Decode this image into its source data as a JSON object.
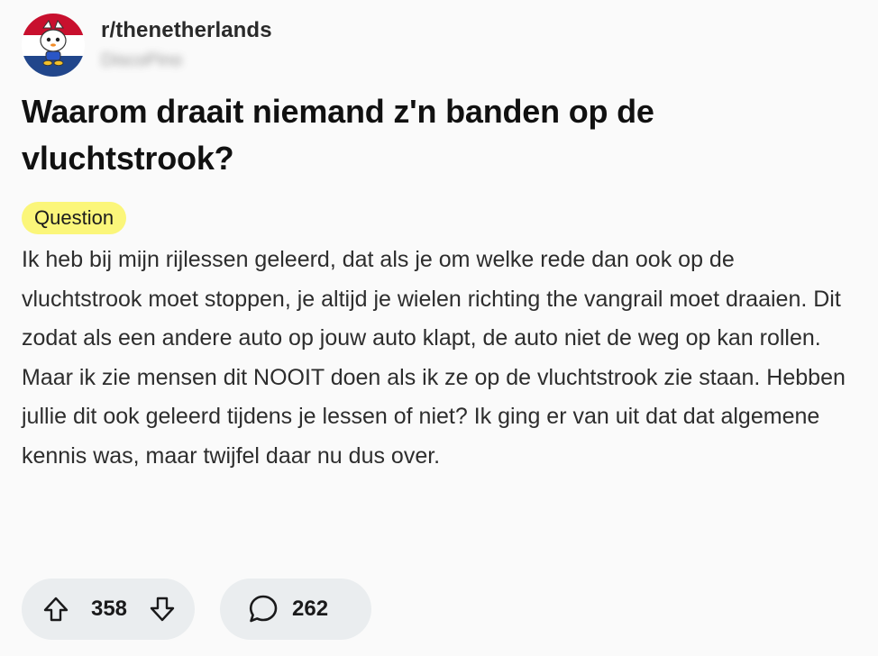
{
  "post": {
    "subreddit": "r/thenetherlands",
    "username": "DiscoPino",
    "title": "Waarom draait niemand z'n banden op de vluchtstrook?",
    "flair": "Question",
    "body": "Ik heb bij mijn rijlessen geleerd, dat als je om welke rede dan ook op de vluchtstrook moet stoppen, je altijd je wielen richting the vangrail moet draaien. Dit zodat als een andere auto op jouw auto klapt, de auto niet de weg op kan rollen. Maar ik zie mensen dit NOOIT doen als ik ze op de vluchtstrook zie staan. Hebben jullie dit ook geleerd tijdens je lessen of niet? Ik ging er van uit dat dat algemene kennis was, maar twijfel daar nu dus over.",
    "vote_count": "358",
    "comment_count": "262"
  },
  "icons": {
    "upvote": "arrow-up-icon",
    "downvote": "arrow-down-icon",
    "comment": "speech-bubble-icon"
  },
  "colors": {
    "background": "#fafafa",
    "flair_bg": "#fbf67a",
    "pill_bg": "#eaedef",
    "flag_red": "#c8102e",
    "flag_white": "#ffffff",
    "flag_blue": "#21468b"
  }
}
